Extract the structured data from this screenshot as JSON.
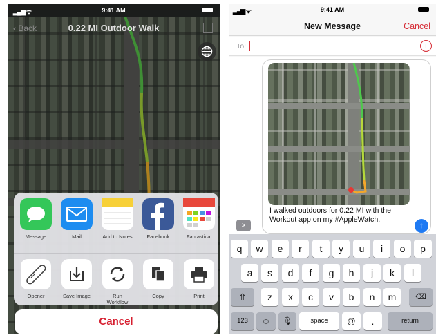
{
  "left_phone": {
    "status": {
      "time": "9:41 AM",
      "signal": "•••• ᵤ"
    },
    "nav": {
      "back_label": "< Back",
      "title": "0.22 MI Outdoor Walk"
    },
    "share_apps": [
      {
        "label": "Message",
        "icon": "messages-icon",
        "color": "#34c759"
      },
      {
        "label": "Mail",
        "icon": "mail-icon",
        "color": "#1d8cf0"
      },
      {
        "label": "Add to Notes",
        "icon": "notes-icon",
        "color": "#f7d038"
      },
      {
        "label": "Facebook",
        "icon": "facebook-icon",
        "color": "#3b5998"
      },
      {
        "label": "Fantastical",
        "icon": "fantastical-icon",
        "color": "#e8473b"
      }
    ],
    "share_actions": [
      {
        "label": "Opener",
        "icon": "opener-icon"
      },
      {
        "label": "Save Image",
        "icon": "save-image-icon"
      },
      {
        "label": "Run\nWorkflow",
        "icon": "run-workflow-icon"
      },
      {
        "label": "Copy",
        "icon": "copy-icon"
      },
      {
        "label": "Print",
        "icon": "print-icon"
      }
    ],
    "cancel_label": "Cancel",
    "accent_color": "#d61e2f"
  },
  "right_phone": {
    "status": {
      "time": "9:41 AM",
      "signal": "•••• ᵤ"
    },
    "nav": {
      "title": "New Message",
      "cancel_label": "Cancel"
    },
    "to_label": "To:",
    "message_text": "I walked outdoors for 0.22 MI with the Workout app on my #AppleWatch.",
    "send_icon": "↑",
    "expand_icon": ">",
    "keyboard": {
      "row1": [
        "q",
        "w",
        "e",
        "r",
        "t",
        "y",
        "u",
        "i",
        "o",
        "p"
      ],
      "row2": [
        "a",
        "s",
        "d",
        "f",
        "g",
        "h",
        "j",
        "k",
        "l"
      ],
      "row3": [
        "z",
        "x",
        "c",
        "v",
        "b",
        "n",
        "m"
      ],
      "numbers_label": "123",
      "space_label": "space",
      "at_label": "@",
      "dot_label": ".",
      "return_label": "return"
    },
    "accent_color": "#d62c36",
    "send_color": "#1f7af3"
  }
}
